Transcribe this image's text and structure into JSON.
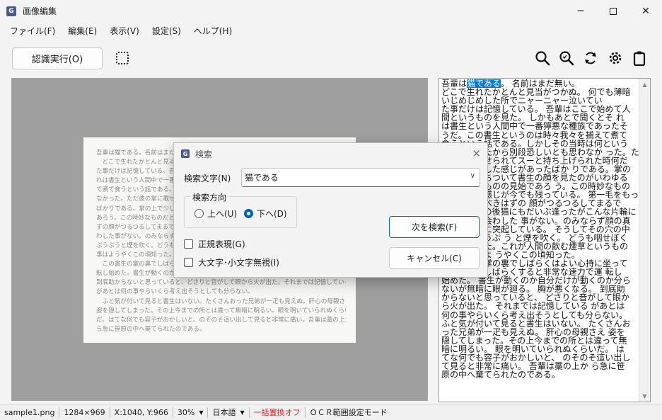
{
  "window": {
    "title": "画像編集",
    "app_icon": "G"
  },
  "menu": [
    "ファイル(F)",
    "編集(E)",
    "表示(V)",
    "設定(S)",
    "ヘルプ(H)"
  ],
  "toolbar": {
    "ocr_button": "認識実行(O)"
  },
  "document_lines": [
    "吾輩は猫である。名前はまだ無い。",
    "どこで生れたかとんと見当がつかぬ。何でも薄暗いじめじめした所でニャーニャー泣いてい",
    "た事だけは記憶している。吾輩はここで始めて人間というものを見た。しかもあとで聞くとそ",
    "れは書生という人間中で一番獰悪な種族であったそうだ。この書生というのは時々我々を捕え",
    "て煮て食うという話である。しかしその当時は何という考もなかったから別段恐しいとも思わ",
    "なかった。ただ彼の掌に載せられてスーと持ち上げられた時何だかフワフワした感じがあった",
    "ばかりである。掌の上で少し落ちついて書生の顔を見たのがいわゆる人間というものの見始で",
    "あろう。この時妙なものだと思った感じが今でも残っている。第一毛をもって装飾されべきは",
    "ずの顔がつるつるしてまるで薬缶だ。その後猫にもだいぶ逢ったがこんな片輪には一度も出会",
    "わした事がない。のみならず顔の真中があまりに突起している。そうしてその穴の中から時々",
    "ぷうぷうと煙を吹く。どうも咽せぽくて実に弱った。これが人間の飲む煙草というものである",
    "事はようやくこの頃知った。",
    "この書生の掌の裏でしばらくはよい心持に坐っておったが、しばらくすると非常な速力で運",
    "転し始めた。書生が動くのか自分だけが動くのか分らないが無暗に眼が廻る。胸が悪くなる。",
    "到底助からないと思っていると、どさりと音がして眼から火が出た。それまでは記憶している",
    "があとは何の事やらいくら考え出そうとしても分らない。",
    "ふと気が付いて見ると書生はいない。たくさんおった兄弟が一疋も見えぬ。肝心の母親さえ",
    "姿を隠してしまった。その上今までの所とは違って無暗に明るい。眼を明いていられぬくらい",
    "だ。はてな何でも容子がおかしいと、のそのそ這い出して見ると非常に痛い。吾輩は藁の上か",
    "ら急に笹原の中へ棄てられたのである。"
  ],
  "ocr_text": {
    "highlight": "猫である",
    "before_highlight": "吾輩は",
    "after_highlight": "。 名前はまだ無い。",
    "lines": [
      "どこで生れたかとんと見当がつかぬ。 何でも薄暗",
      "いじめじめした所でニャーニャー泣いてい",
      "た事だけは記憶している。 吾輩はここで始めて人",
      "間というものを見た。 しかもあとで聞くとそ れ",
      "は書生という人間中で一番獰悪な種族であったそ",
      "うだ。この書生というのは時々我々を捕えて煮て",
      "食うという話である。しかしその当時は何という",
      "考もなかったから別段恐しいとも思わなか った。ただ",
      "彼の掌に載せられてスーと持ち上げられた時何だ",
      "かフワフワした感じがあったばか りである。掌の",
      "上で少し落ちついて書生の顔を見たのがいわゆる",
      "人間というものの見始であろ う。この時妙なもの",
      "だと思った感じが今でも残っている。 第一毛をもっ",
      "て装飾されべきはずの 顔がつるつるしてまるで",
      "薬缶だ。その後猫にもだいぶ逢ったがこんな片輪に",
      "は一度も出会わした 事がない。のみならず顔の真",
      "中があまりに突起している。 そうしてその穴の中",
      "から時々ぷうぷ う と煙を吹く。 どうも咽せぽく",
      "て実に弱った。これが人間の飲む煙草というもの",
      "である事はよ うやくこの頃知った。",
      "この書生の掌の裏でしばらくはよい心持に坐って",
      "おったが、しばらくすると非常な速力で運 転し",
      "始めた。 書生が動くのか自分だけが動くのか分ら",
      "ないが無暗に眼が廻る。 胸が悪くなる。 到底助",
      "からないと思っていると、 どさりと音がして眼か",
      "ら火が出た。 それまでは記憶している があとは",
      "何の事やらいくら考え出そうとしても分らない。",
      "ふと気が付いて見ると書生はいない。 たくさんお",
      "った兄弟が一疋も見えぬ。 肝心の母親さえ 姿を",
      "隠してしまった。その上今までの所とは違って無",
      "暗に明るい。 眼を明いていられぬくらいだ。 は",
      "てな何でも容子がおかしいと、 のそのそ這い出し",
      "て見ると非常に痛い。 吾輩は藁の上か ら急に笹",
      "原の中へ棄てられたのである。"
    ]
  },
  "dialog": {
    "title": "検索",
    "search_label": "検索文字(N)",
    "search_value": "猫である",
    "direction_label": "検索方向",
    "dir_up": "上へ(U)",
    "dir_down": "下へ(D)",
    "regex_label": "正規表現(G)",
    "case_label": "大文字･小文字無視(I)",
    "next_button": "次を検索(F)",
    "cancel_button": "キャンセル(C)"
  },
  "status": {
    "file": "sample1.png",
    "size": "1284×969",
    "coords": "X:1040, Y:966",
    "zoom": "30%",
    "language": "日本語",
    "replace": "一括置換オフ",
    "mode": "ＯＣＲ範囲設定モード"
  },
  "colors": {
    "highlight": "#0078d7",
    "status_red": "#e02020",
    "accent": "#005fb8"
  }
}
